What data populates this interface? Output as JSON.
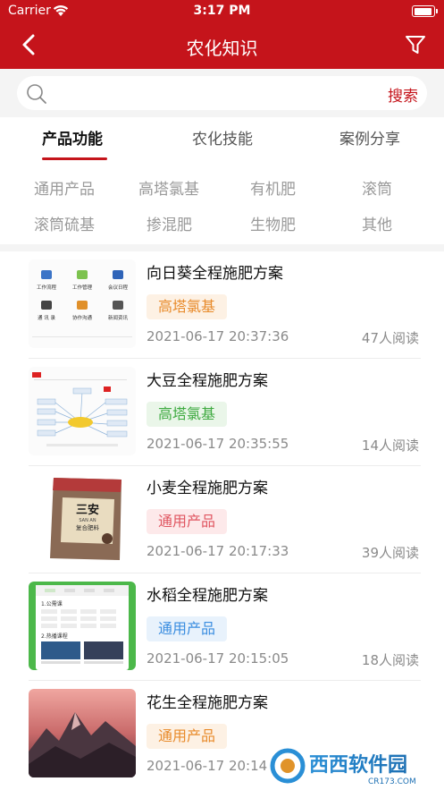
{
  "status_bar": {
    "carrier": "Carrier",
    "time": "3:17 PM"
  },
  "nav": {
    "title": "农化知识"
  },
  "search": {
    "placeholder": "",
    "button_label": "搜索"
  },
  "tabs": [
    {
      "label": "产品功能",
      "active": true
    },
    {
      "label": "农化技能",
      "active": false
    },
    {
      "label": "案例分享",
      "active": false
    }
  ],
  "categories": [
    "通用产品",
    "高塔氯基",
    "有机肥",
    "滚筒",
    "滚筒硫基",
    "掺混肥",
    "生物肥",
    "其他"
  ],
  "articles": [
    {
      "title": "向日葵全程施肥方案",
      "tag": "高塔氯基",
      "tag_color": "orange",
      "date": "2021-06-17 20:37:36",
      "reads": "47人阅读",
      "thumb": "app-grid"
    },
    {
      "title": "大豆全程施肥方案",
      "tag": "高塔氯基",
      "tag_color": "green",
      "date": "2021-06-17 20:35:55",
      "reads": "14人阅读",
      "thumb": "mind-map"
    },
    {
      "title": "小麦全程施肥方案",
      "tag": "通用产品",
      "tag_color": "red",
      "date": "2021-06-17 20:17:33",
      "reads": "39人阅读",
      "thumb": "fertilizer-bag"
    },
    {
      "title": "水稻全程施肥方案",
      "tag": "通用产品",
      "tag_color": "blue",
      "date": "2021-06-17 20:15:05",
      "reads": "18人阅读",
      "thumb": "phone-screen"
    },
    {
      "title": "花生全程施肥方案",
      "tag": "通用产品",
      "tag_color": "orange",
      "date": "2021-06-17 20:14",
      "reads": "",
      "thumb": "mountain"
    }
  ],
  "thumb_texts": {
    "app_grid": [
      "工作流程",
      "工作管理",
      "会议日程",
      "通 讯 录",
      "协作沟通",
      "新闻资讯"
    ],
    "bag": {
      "brand": "三安",
      "brand_latin": "SAN AN",
      "sub": "复合肥料"
    },
    "phone": {
      "section1": "1.公需课",
      "section2": "2.热播课程"
    }
  },
  "watermark": {
    "text": "西西软件园",
    "domain": "CR173.COM"
  },
  "colors": {
    "brand": "#c5141b",
    "tag_orange": "#e88a2a",
    "tag_green": "#3eaa40",
    "tag_red": "#e05560",
    "tag_blue": "#3a8de0"
  }
}
